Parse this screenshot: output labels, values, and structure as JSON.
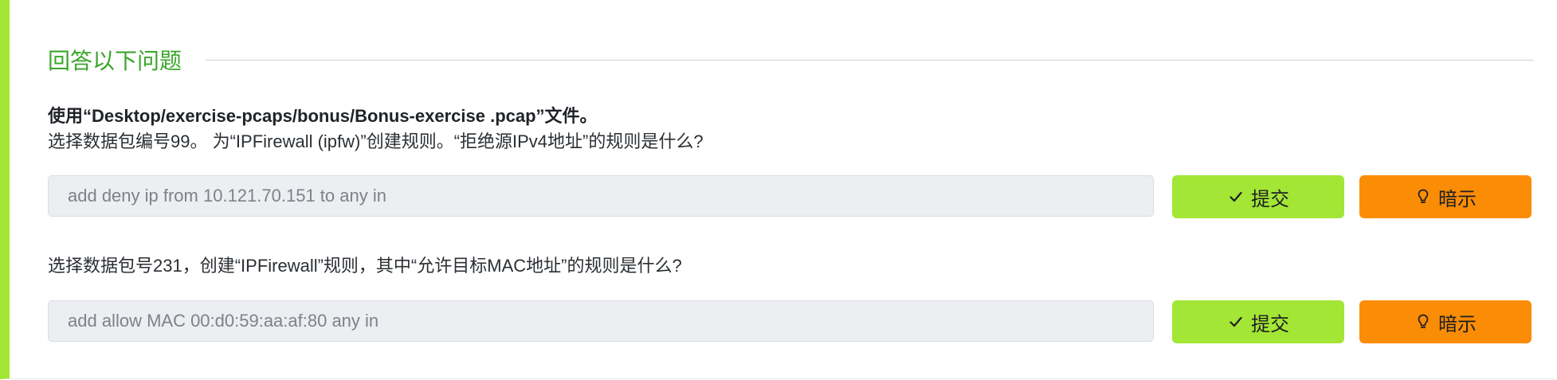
{
  "section": {
    "title": "回答以下问题"
  },
  "question1": {
    "file_line": "使用“Desktop/exercise-pcaps/bonus/Bonus-exercise .pcap”文件。",
    "prompt": "选择数据包编号99。 为“IPFirewall (ipfw)”创建规则。“拒绝源IPv4地址”的规则是什么?",
    "answer_value": "add deny ip from 10.121.70.151 to any in",
    "submit_label": "提交",
    "hint_label": "暗示"
  },
  "question2": {
    "prompt": "选择数据包号231，创建“IPFirewall”规则，其中“允许目标MAC地址”的规则是什么?",
    "answer_value": "add allow MAC 00:d0:59:aa:af:80 any in",
    "submit_label": "提交",
    "hint_label": "暗示"
  },
  "icons": {
    "submit": "checkmark-icon",
    "hint": "lightbulb-icon"
  },
  "colors": {
    "accent_green": "#a3e635",
    "title_green": "#3aa62a",
    "hint_orange": "#fb8c06"
  }
}
